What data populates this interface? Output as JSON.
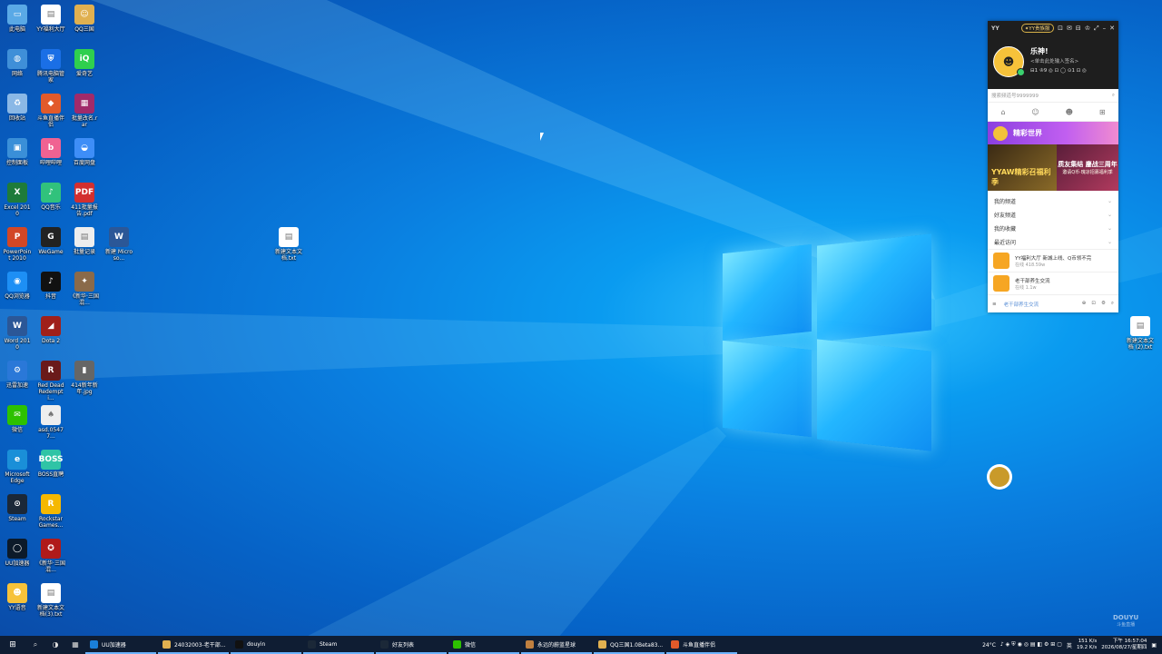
{
  "desktop": {
    "icons": [
      {
        "label": "此电脑",
        "color": "#5aa9e6",
        "glyph": "▭"
      },
      {
        "label": "YY福利大厅",
        "color": "#ffffff",
        "glyph": "▤"
      },
      {
        "label": "QQ三国",
        "color": "#e0b050",
        "glyph": "☺"
      },
      {
        "label": "网络",
        "color": "#3f8fd8",
        "glyph": "◍"
      },
      {
        "label": "腾讯电脑管家",
        "color": "#1a6fe6",
        "glyph": "⛨"
      },
      {
        "label": "爱奇艺",
        "color": "#2fcf4e",
        "glyph": "iQ"
      },
      {
        "label": "回收站",
        "color": "#8ab8e6",
        "glyph": "♻"
      },
      {
        "label": "斗鱼直播伴侣",
        "color": "#e25a2a",
        "glyph": "◆"
      },
      {
        "label": "批量改名.rar",
        "color": "#a02a6a",
        "glyph": "▦"
      },
      {
        "label": "控制面板",
        "color": "#3a8fd8",
        "glyph": "▣"
      },
      {
        "label": "哔哩哔哩",
        "color": "#f06292",
        "glyph": "b"
      },
      {
        "label": "百度网盘",
        "color": "#3e8ef7",
        "glyph": "◒"
      },
      {
        "label": "Excel 2010",
        "color": "#1e7b3a",
        "glyph": "X"
      },
      {
        "label": "QQ音乐",
        "color": "#31c27c",
        "glyph": "♪"
      },
      {
        "label": "411批量报告.pdf",
        "color": "#d32f2f",
        "glyph": "PDF"
      },
      {
        "label": "PowerPoint 2010",
        "color": "#d24726",
        "glyph": "P"
      },
      {
        "label": "WeGame",
        "color": "#222222",
        "glyph": "G"
      },
      {
        "label": "批量记录",
        "color": "#eeeeee",
        "glyph": "▤"
      },
      {
        "label": "新建 Microso...",
        "color": "#2b5797",
        "glyph": "W"
      },
      {
        "label": "QQ浏览器",
        "color": "#1d8ff5",
        "glyph": "◉"
      },
      {
        "label": "抖音",
        "color": "#111111",
        "glyph": "♪"
      },
      {
        "label": "《新华·三国 混...",
        "color": "#8a6a4a",
        "glyph": "✦"
      },
      {
        "label": "Word 2010",
        "color": "#2b5797",
        "glyph": "W"
      },
      {
        "label": "Dota 2",
        "color": "#a0201a",
        "glyph": "◢"
      },
      {
        "label": "迅雷加速",
        "color": "#2a78d8",
        "glyph": "⚙"
      },
      {
        "label": "Red Dead Redempti...",
        "color": "#6a1a1a",
        "glyph": "R"
      },
      {
        "label": "414新年新年.jpg",
        "color": "#666666",
        "glyph": "▮"
      },
      {
        "label": "微信",
        "color": "#2dc100",
        "glyph": "✉"
      },
      {
        "label": "asd.05477...",
        "color": "#eeeeee",
        "glyph": "♠"
      },
      {
        "label": "Microsoft Edge",
        "color": "#1a8fd8",
        "glyph": "e"
      },
      {
        "label": "BOSS直聘",
        "color": "#2fc4a6",
        "glyph": "BOSS"
      },
      {
        "label": "Steam",
        "color": "#1b2838",
        "glyph": "⊙"
      },
      {
        "label": "Rockstar Games...",
        "color": "#f5b800",
        "glyph": "R"
      },
      {
        "label": "UU加速器",
        "color": "#0c1a2a",
        "glyph": "◯"
      },
      {
        "label": "《新华·三国 混...",
        "color": "#b01a1a",
        "glyph": "✪"
      },
      {
        "label": "YY语音",
        "color": "#f6c23a",
        "glyph": "☻"
      },
      {
        "label": "新建文本文档(3).txt",
        "color": "#ffffff",
        "glyph": "▤"
      },
      {
        "label": "新建文本文档.txt",
        "color": "#ffffff",
        "glyph": "▤"
      },
      {
        "label": "新建文本文档 (2).txt",
        "color": "#ffffff",
        "glyph": "▤"
      }
    ]
  },
  "yy": {
    "logo": "YY",
    "badge": "✦YY贵族服",
    "controls": [
      "⊡",
      "✉",
      "⊟",
      "♔",
      "⤢",
      "–",
      "✕"
    ],
    "avatar_glyph": "☻",
    "username": "乐神!",
    "signature": "<单击此处输入签名>",
    "stats": "⊟1 ♔9 ◎ ⊡ ◯ ⊙1 ⊡ ◎",
    "search_placeholder": "搜索频道号9999999",
    "search_icon": "⌕",
    "nav_icons": [
      "⌂",
      "☺",
      "☻",
      "⊞"
    ],
    "banner1_text": "精彩世界",
    "banner2a_text": "YYAW精彩召福利季",
    "banner2b_title": "质友集结 鏖战三周年",
    "banner2b_sub": "邀请Q币·瑰凉招募福利季",
    "list": [
      {
        "label": "我的频道",
        "chev": "⌄"
      },
      {
        "label": "好友频道",
        "chev": "⌄"
      },
      {
        "label": "我的收藏",
        "chev": "⌄"
      },
      {
        "label": "最近访问",
        "chev": "⌄"
      }
    ],
    "items": [
      {
        "title": "YY福利大厅 新城上线、Q币领不完",
        "sub": "在线 418.59w"
      },
      {
        "title": "老干部养生交流",
        "sub": "在线 1.1w"
      }
    ],
    "bottom_menu": "≡",
    "bottom_text": "老干部养生交流",
    "bottom_icons": [
      "⊕",
      "⊡",
      "⚙",
      "⌕"
    ]
  },
  "taskbar": {
    "start_icon": "⊞",
    "quick": [
      "⌕",
      "◑",
      "▦"
    ],
    "buttons": [
      {
        "label": "UU加速器",
        "color": "#1a7fd8"
      },
      {
        "label": "24032003-老干部...",
        "color": "#e0b050"
      },
      {
        "label": "douyin",
        "color": "#111111"
      },
      {
        "label": "Steam",
        "color": "#1b2838"
      },
      {
        "label": "好友列表",
        "color": "#1b2838"
      },
      {
        "label": "微信",
        "color": "#2dc100"
      },
      {
        "label": "永远的蔚蓝星球",
        "color": "#c08040"
      },
      {
        "label": "QQ三国1.0Beta83...",
        "color": "#e0b050"
      },
      {
        "label": "斗鱼直播伴侣",
        "color": "#e25a2a"
      }
    ],
    "weather": "24°C",
    "tray_icons": "♪ ◈ ⛨ ◉ ◎ ▤ ◧ ⚙ ⊞ ▢",
    "ime": "英",
    "net_up": "151 K/s",
    "net_down": "19.2 K/s",
    "time": "下午 16:57:04",
    "date": "2026/08/27/星期四",
    "notify": "▣"
  },
  "watermark": {
    "title": "DOUYU",
    "sub": "斗鱼直播"
  }
}
